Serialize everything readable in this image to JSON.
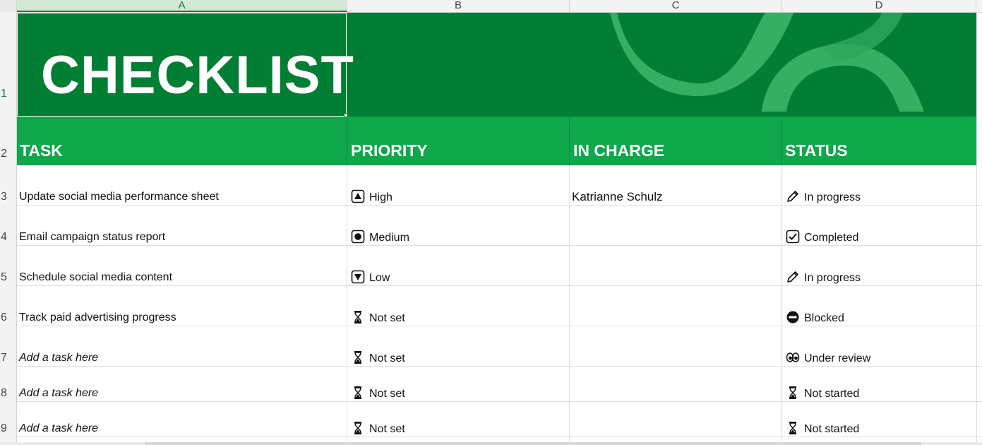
{
  "colors": {
    "banner": "#007e33",
    "header": "#0ea84a",
    "accent": "#107c41"
  },
  "columns": [
    "A",
    "B",
    "C",
    "D"
  ],
  "row_numbers": [
    "1",
    "2",
    "3",
    "4",
    "5",
    "6",
    "7",
    "8",
    "9"
  ],
  "title": "CHECKLIST",
  "headers": {
    "task": "TASK",
    "priority": "PRIORITY",
    "in_charge": "IN CHARGE",
    "status": "STATUS"
  },
  "rows": [
    {
      "task": "Update social media performance sheet",
      "priority": "High",
      "priority_icon": "triangle-up-box-icon",
      "in_charge": "Katrianne Schulz",
      "status": "In progress",
      "status_icon": "pencil-icon"
    },
    {
      "task": "Email campaign status report",
      "priority": "Medium",
      "priority_icon": "circle-box-icon",
      "in_charge": "",
      "status": "Completed",
      "status_icon": "checkbox-icon"
    },
    {
      "task": "Schedule social media content",
      "priority": "Low",
      "priority_icon": "triangle-down-box-icon",
      "in_charge": "",
      "status": "In progress",
      "status_icon": "pencil-icon"
    },
    {
      "task": "Track paid advertising progress",
      "priority": "Not set",
      "priority_icon": "hourglass-icon",
      "in_charge": "",
      "status": "Blocked",
      "status_icon": "no-entry-icon"
    },
    {
      "task": "Add a task here",
      "priority": "Not set",
      "priority_icon": "hourglass-icon",
      "in_charge": "",
      "status": "Under review",
      "status_icon": "eyes-icon"
    },
    {
      "task": "Add a task here",
      "priority": "Not set",
      "priority_icon": "hourglass-icon",
      "in_charge": "",
      "status": "Not started",
      "status_icon": "hourglass-icon"
    },
    {
      "task": "Add a task here",
      "priority": "Not set",
      "priority_icon": "hourglass-icon",
      "in_charge": "",
      "status": "Not started",
      "status_icon": "hourglass-icon"
    }
  ]
}
